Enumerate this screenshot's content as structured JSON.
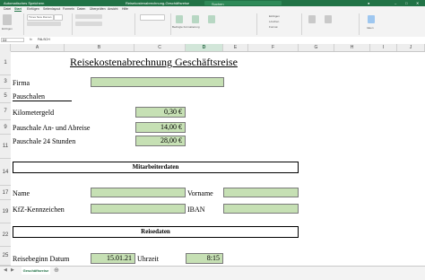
{
  "titlebar": {
    "autosave": "Automatisches Speichern",
    "filename": "Reisekostenabrechnung-Geschäftsreise",
    "search": "Suchen"
  },
  "tabs": [
    "Datei",
    "Start",
    "Einfügen",
    "Seitenlayout",
    "Formeln",
    "Daten",
    "Überprüfen",
    "Ansicht",
    "Hilfe"
  ],
  "ribbon": {
    "font": "Times New Roman",
    "paste": "Einfügen",
    "formatting": "Bedingte Formatierung",
    "as_table": "Als Tabelle formatieren",
    "cell_styles": "Zellenformatvorlagen",
    "insert": "Einfügen",
    "delete": "Löschen",
    "format": "Format",
    "sort": "Sortieren und Filtern",
    "find": "Suchen und Auswählen",
    "ideas": "Ideen"
  },
  "formulabar": {
    "namebox": "D2",
    "fx": "fx",
    "value": "FALSCH"
  },
  "columns": [
    "A",
    "B",
    "C",
    "D",
    "E",
    "F",
    "G",
    "H",
    "I",
    "J"
  ],
  "rows": [
    "1",
    "3",
    "5",
    "7",
    "9",
    "11",
    "14",
    "17",
    "19",
    "22",
    "25"
  ],
  "sheet": {
    "title": "Reisekostenabrechnung Geschäftsreise",
    "firma": "Firma",
    "pauschalen": "Pauschalen",
    "kilometergeld": "Kilometergeld",
    "kilometergeld_value": "0,30 €",
    "an_abreise": "Pauschale An- und Abreise",
    "an_abreise_value": "14,00 €",
    "pauschale24": "Pauschale 24 Stunden",
    "pauschale24_value": "28,00 €",
    "mitarbeiterdaten": "Mitarbeiterdaten",
    "name": "Name",
    "vorname": "Vorname",
    "kfz": "KfZ-Kennzeichen",
    "iban": "IBAN",
    "reisedaten": "Reisedaten",
    "reisebeginn": "Reisebeginn Datum",
    "reisebeginn_value": "15.01.21",
    "uhrzeit": "Uhrzeit",
    "uhrzeit_value": "8:15"
  },
  "sheettab": "Geschäftsreise",
  "colors": {
    "accent": "#217346",
    "input_fill": "#c6e0b4"
  }
}
